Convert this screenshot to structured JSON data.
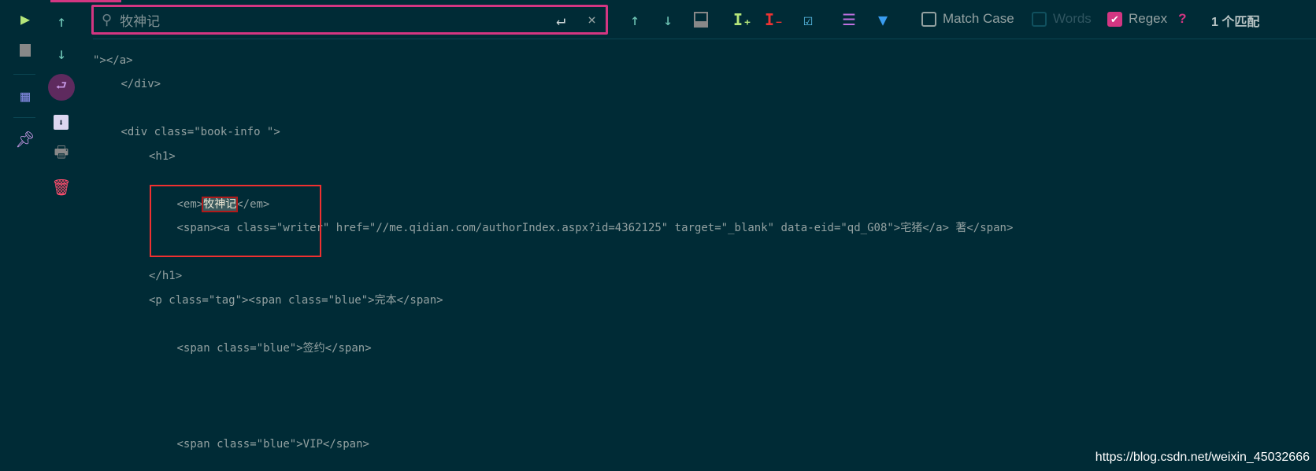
{
  "search": {
    "value": "牧神记",
    "placeholder": ""
  },
  "options": {
    "match_case": "Match Case",
    "words": "Words",
    "regex": "Regex",
    "help": "?",
    "match_count": "1 个匹配"
  },
  "states": {
    "match_case": false,
    "words": false,
    "regex": true
  },
  "code_lines": [
    {
      "indent": 0,
      "text": "\"></a>"
    },
    {
      "indent": 1,
      "text": "</div>"
    },
    {
      "indent": 1,
      "text": "<div class=\"book-info \">"
    },
    {
      "indent": 2,
      "text": "<h1>"
    },
    {
      "indent": 3,
      "pre": "<em>",
      "match": "牧神记",
      "post": "</em>"
    },
    {
      "indent": 3,
      "text": "<span><a class=\"writer\" href=\"//me.qidian.com/authorIndex.aspx?id=4362125\" target=\"_blank\" data-eid=\"qd_G08\">宅猪</a> 著</span>"
    },
    {
      "indent": 2,
      "text": "</h1>"
    },
    {
      "indent": 2,
      "text": "<p class=\"tag\"><span class=\"blue\">完本</span>"
    },
    {
      "indent": 3,
      "text": "<span class=\"blue\">签约</span>"
    },
    {
      "indent": 3,
      "text": "<span class=\"blue\">VIP</span>"
    }
  ],
  "watermark": "https://blog.csdn.net/weixin_45032666",
  "colors": {
    "background": "#002b36",
    "accent": "#d33682",
    "highlight_border": "#f03030"
  }
}
